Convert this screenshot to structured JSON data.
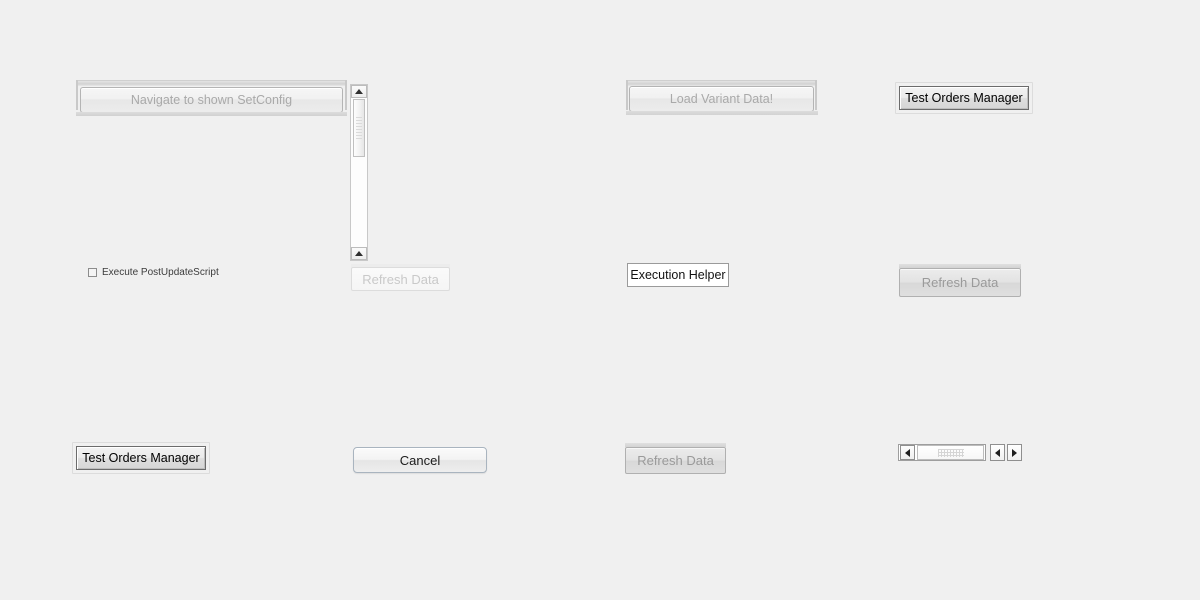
{
  "window": {
    "background_color": "#f0f0f0"
  },
  "controls": {
    "navigate_button": {
      "label": "Navigate to shown SetConfig",
      "state": "disabled",
      "text_color": "#a9a9a9"
    },
    "load_variant_button": {
      "label": "Load Variant Data!",
      "state": "disabled",
      "text_color": "#a9a9a9"
    },
    "test_orders_manager_top": {
      "label": "Test Orders Manager",
      "state": "enabled",
      "text_color": "#000000"
    },
    "test_orders_manager_bottom": {
      "label": "Test Orders Manager",
      "state": "enabled",
      "text_color": "#000000"
    },
    "execute_post_update_checkbox": {
      "label": "Execute PostUpdateScript",
      "checked": false
    },
    "refresh_data_faint": {
      "label": "Refresh Data",
      "state": "disabled",
      "text_color": "#c9c9c9"
    },
    "refresh_data_right": {
      "label": "Refresh Data",
      "state": "disabled",
      "text_color": "#9a9a9a"
    },
    "refresh_data_bottom": {
      "label": "Refresh Data",
      "state": "disabled",
      "text_color": "#9a9a9a"
    },
    "execution_helper_label": {
      "label": "Execution Helper",
      "text_color": "#111111",
      "background_color": "#ffffff"
    },
    "cancel_button": {
      "label": "Cancel",
      "state": "enabled",
      "text_color": "#1b1b1b"
    },
    "vertical_scrollbar": {
      "up_arrow_icon": "triangle-up-icon",
      "down_arrow_icon": "triangle-up-icon",
      "thumb_icon": "scroll-thumb-grip"
    },
    "horizontal_scrollbar": {
      "left_arrow_icon": "triangle-left-icon",
      "thumb_icon": "scroll-thumb-grip",
      "spinner_left_icon": "triangle-left-icon",
      "spinner_right_icon": "triangle-right-icon"
    }
  }
}
